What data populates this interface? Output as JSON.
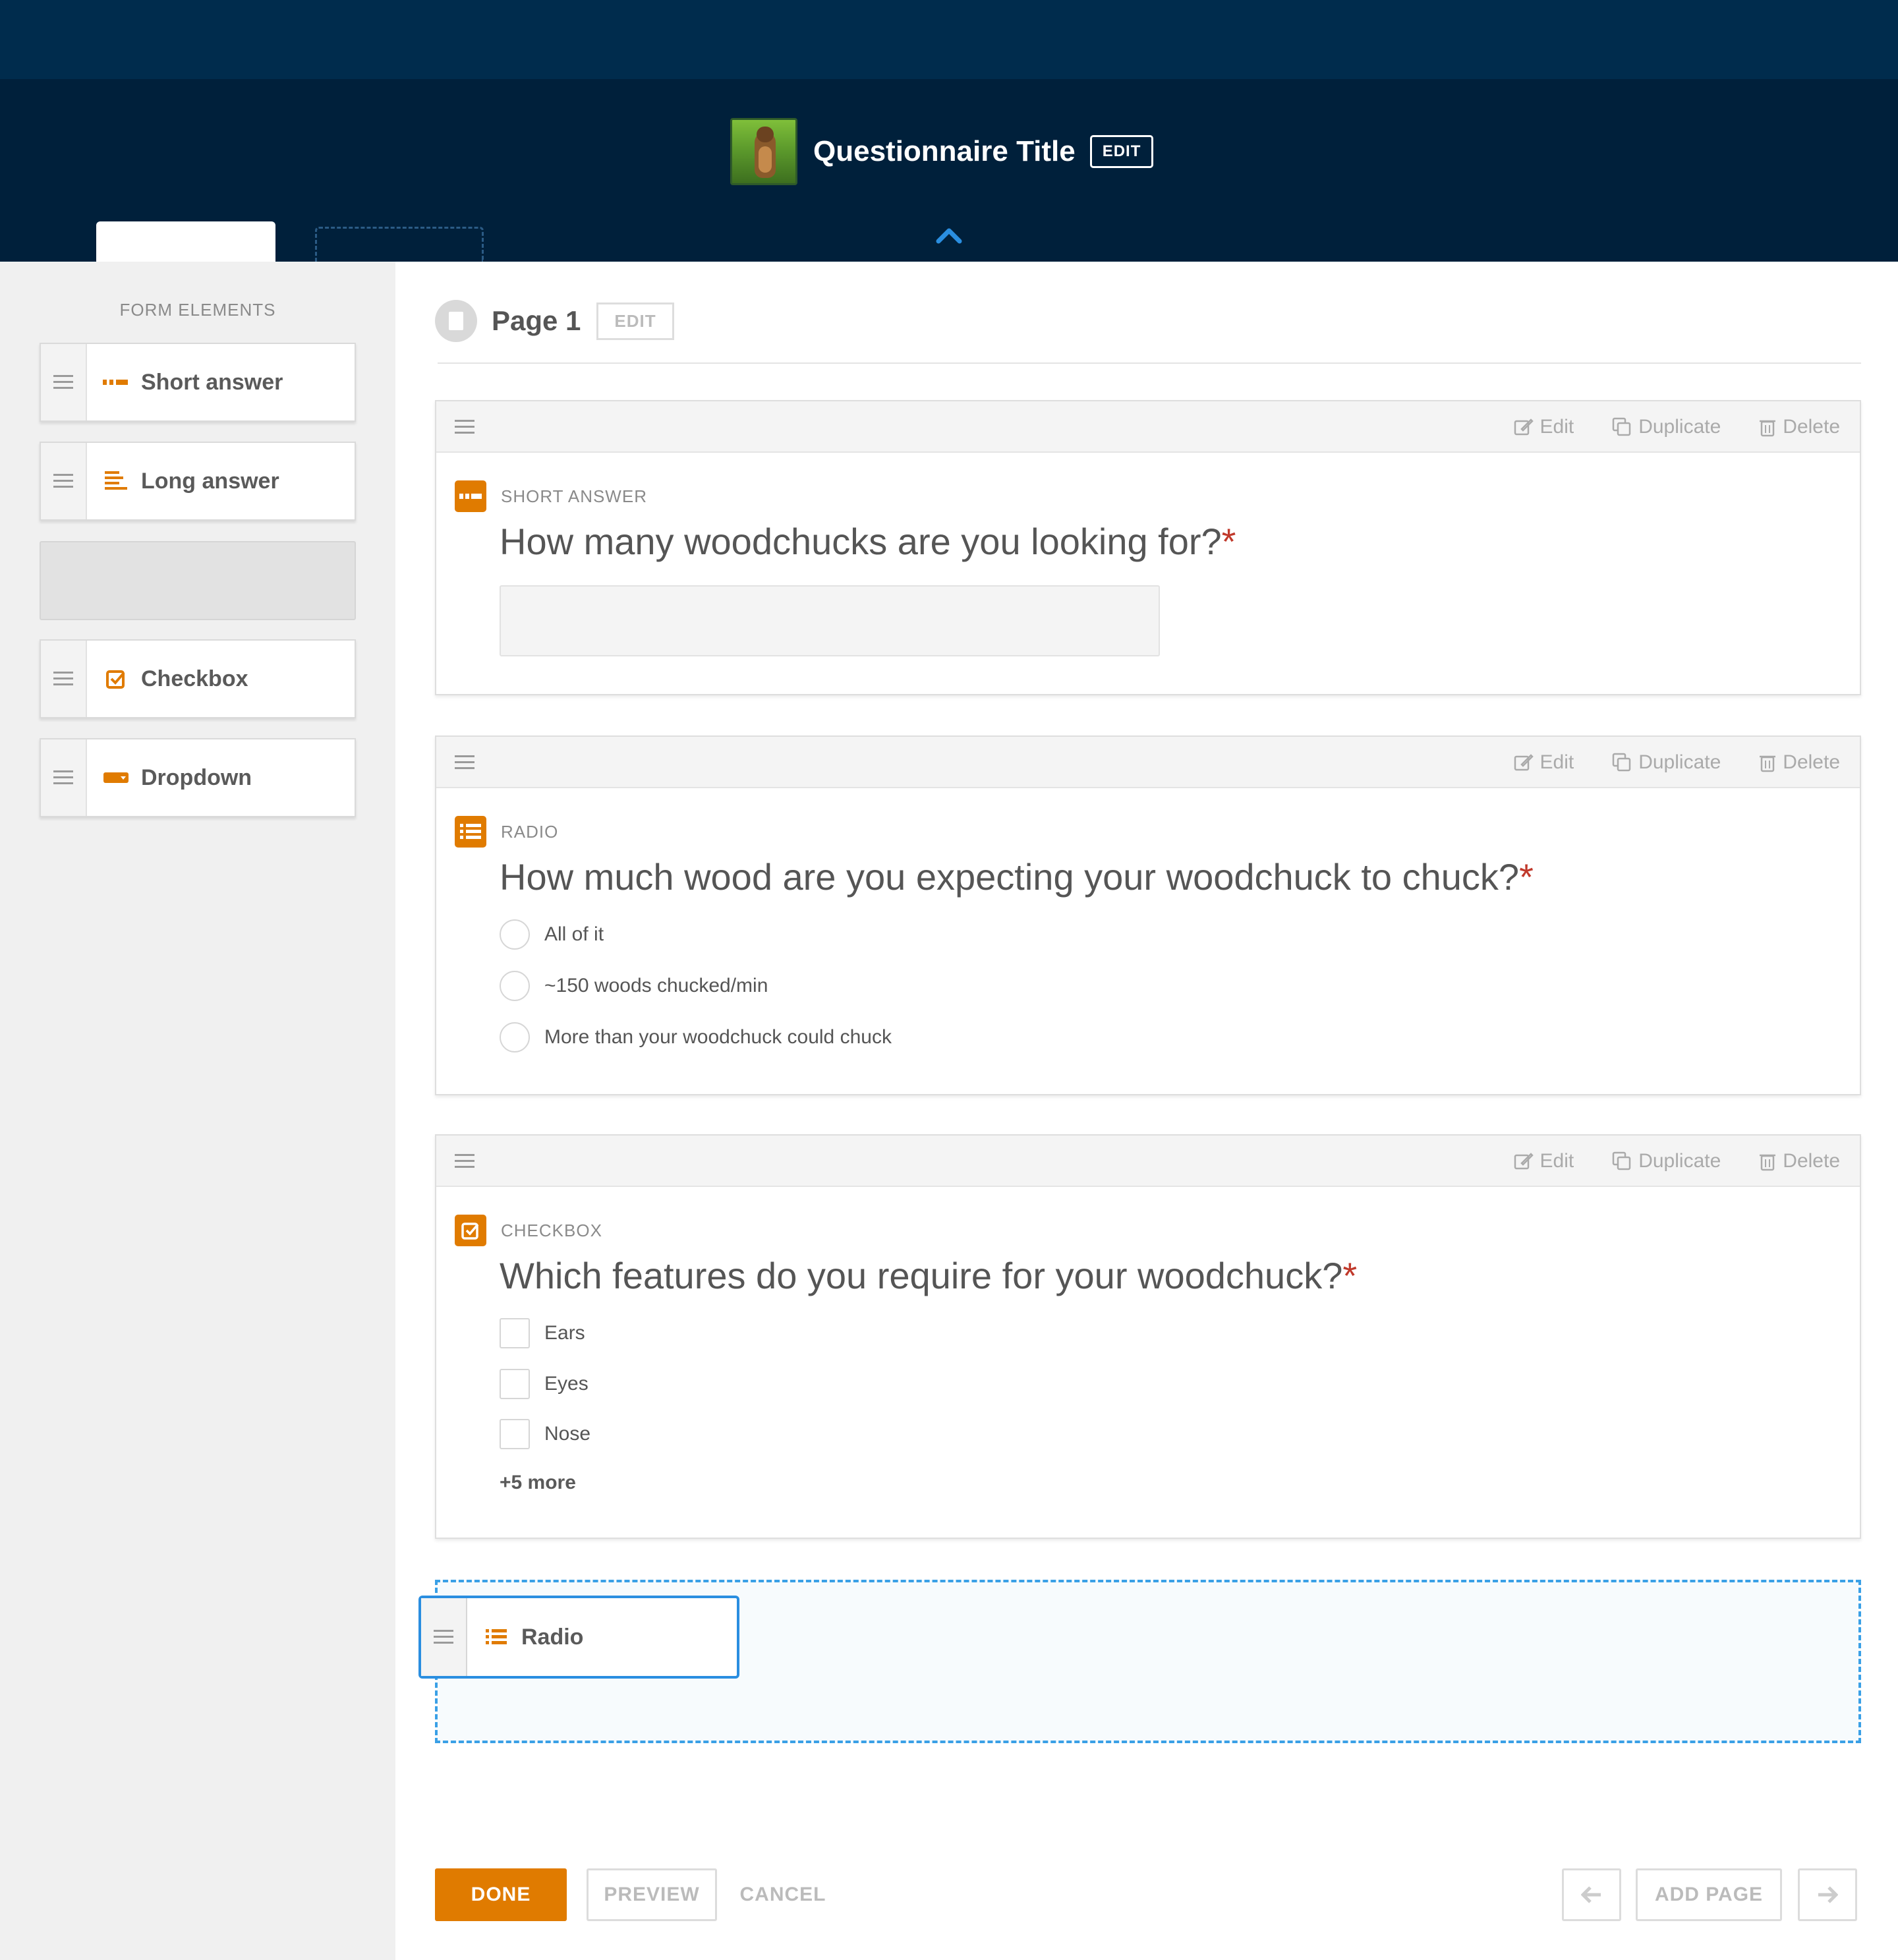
{
  "header": {
    "title": "Questionnaire Title",
    "edit_label": "EDIT"
  },
  "sidebar": {
    "label": "FORM ELEMENTS",
    "items": [
      {
        "label": "Short answer",
        "icon": "short-answer-icon"
      },
      {
        "label": "Long answer",
        "icon": "long-answer-icon"
      },
      {
        "label": "Checkbox",
        "icon": "checkbox-icon"
      },
      {
        "label": "Dropdown",
        "icon": "dropdown-icon"
      }
    ]
  },
  "page": {
    "title": "Page 1",
    "edit_label": "EDIT"
  },
  "card_actions": {
    "edit": "Edit",
    "duplicate": "Duplicate",
    "delete": "Delete"
  },
  "questions": [
    {
      "type_label": "SHORT ANSWER",
      "text": "How many woodchucks are you looking for?",
      "required_mark": "*"
    },
    {
      "type_label": "RADIO",
      "text": "How much wood are you expecting your woodchuck to chuck?",
      "required_mark": "*",
      "options": [
        "All of it",
        "~150 woods chucked/min",
        "More than your woodchuck could chuck"
      ]
    },
    {
      "type_label": "CHECKBOX",
      "text": "Which features do you require for your woodchuck?",
      "required_mark": "*",
      "options": [
        "Ears",
        "Eyes",
        "Nose"
      ],
      "more_label": "+5 more"
    }
  ],
  "dragging_item": {
    "label": "Radio",
    "icon": "radio-list-icon"
  },
  "footer": {
    "done": "DONE",
    "preview": "PREVIEW",
    "cancel": "CANCEL",
    "add_page": "ADD PAGE"
  },
  "colors": {
    "accent": "#e07b00",
    "header": "#00203b",
    "topbar": "#002c4d",
    "drop_highlight": "#3aa0e6",
    "required": "#c0392b"
  }
}
